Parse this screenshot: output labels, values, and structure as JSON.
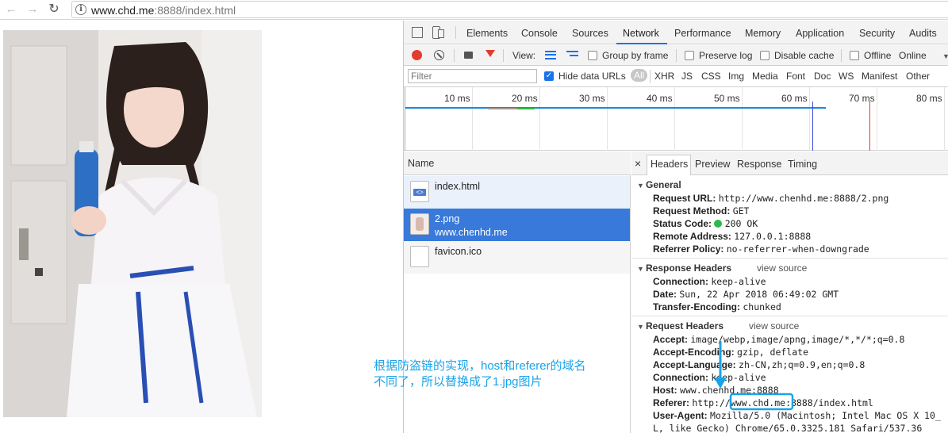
{
  "browser": {
    "nav": {
      "back_icon": "back-arrow-icon",
      "forward_icon": "forward-arrow-icon",
      "reload_icon": "reload-icon"
    },
    "url_host": "www.chd.me",
    "url_rest": ":8888/index.html"
  },
  "devtools": {
    "tabs": [
      "Elements",
      "Console",
      "Sources",
      "Network",
      "Performance",
      "Memory",
      "Application",
      "Security",
      "Audits"
    ],
    "selected_tab": "Network",
    "controls": {
      "view_label": "View:",
      "group_by_frame": "Group by frame",
      "preserve_log": "Preserve log",
      "disable_cache": "Disable cache",
      "offline": "Offline",
      "online": "Online"
    },
    "filter": {
      "placeholder": "Filter",
      "hide_data_urls": "Hide data URLs",
      "types": [
        "All",
        "XHR",
        "JS",
        "CSS",
        "Img",
        "Media",
        "Font",
        "Doc",
        "WS",
        "Manifest",
        "Other"
      ]
    },
    "timeline": {
      "ticks": [
        "10 ms",
        "20 ms",
        "30 ms",
        "40 ms",
        "50 ms",
        "60 ms",
        "70 ms",
        "80 ms"
      ]
    },
    "request_list": {
      "header": "Name",
      "rows": [
        {
          "name": "index.html",
          "sub": ""
        },
        {
          "name": "2.png",
          "sub": "www.chenhd.me"
        },
        {
          "name": "favicon.ico",
          "sub": ""
        }
      ]
    },
    "details": {
      "close": "×",
      "tabs": [
        "Headers",
        "Preview",
        "Response",
        "Timing"
      ],
      "general": {
        "title": "General",
        "rows": [
          {
            "k": "Request URL:",
            "v": "http://www.chenhd.me:8888/2.png"
          },
          {
            "k": "Request Method:",
            "v": "GET"
          },
          {
            "k": "Status Code:",
            "v": "200 OK"
          },
          {
            "k": "Remote Address:",
            "v": "127.0.0.1:8888"
          },
          {
            "k": "Referrer Policy:",
            "v": "no-referrer-when-downgrade"
          }
        ]
      },
      "response_headers": {
        "title": "Response Headers",
        "view_source": "view source",
        "rows": [
          {
            "k": "Connection:",
            "v": "keep-alive"
          },
          {
            "k": "Date:",
            "v": "Sun, 22 Apr 2018 06:49:02 GMT"
          },
          {
            "k": "Transfer-Encoding:",
            "v": "chunked"
          }
        ]
      },
      "request_headers": {
        "title": "Request Headers",
        "view_source": "view source",
        "rows": [
          {
            "k": "Accept:",
            "v": "image/webp,image/apng,image/*,*/*;q=0.8"
          },
          {
            "k": "Accept-Encoding:",
            "v": "gzip, deflate"
          },
          {
            "k": "Accept-Language:",
            "v": "zh-CN,zh;q=0.9,en;q=0.8"
          },
          {
            "k": "Connection:",
            "v": "keep-alive"
          },
          {
            "k": "Host:",
            "v": "www.chenhd.me:8888"
          },
          {
            "k": "Referer:",
            "v": "http://www.chd.me:8888/index.html"
          },
          {
            "k": "User-Agent:",
            "v": "Mozilla/5.0 (Macintosh; Intel Mac OS X 10_"
          },
          {
            "k": "",
            "v": "L, like Gecko) Chrome/65.0.3325.181 Safari/537.36"
          }
        ]
      }
    }
  },
  "annotation": {
    "line1": "根据防盗链的实现，host和referer的域名",
    "line2": "不同了，所以替换成了1.jpg图片"
  },
  "colors": {
    "accent_blue": "#1a73e8",
    "annotation": "#1aa3e8",
    "record_red": "#e33b2e",
    "status_green": "#2db84d"
  }
}
